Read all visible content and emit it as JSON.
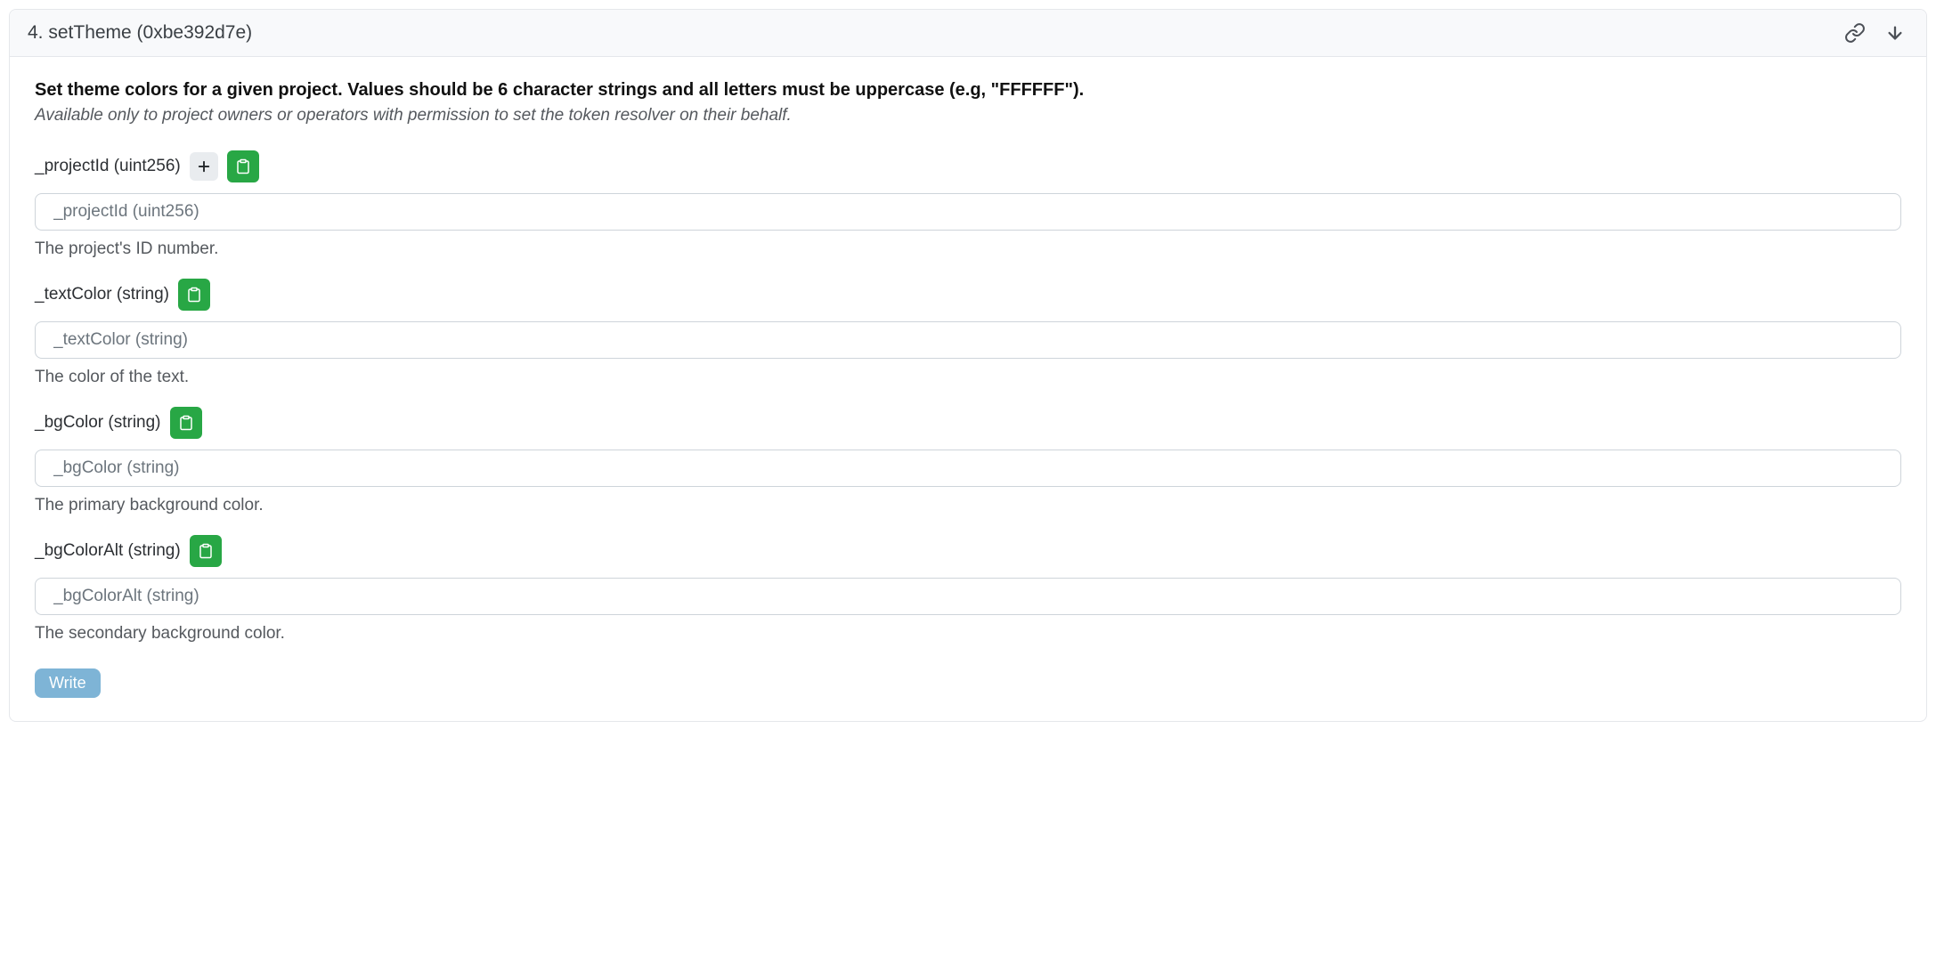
{
  "header": {
    "title": "4. setTheme (0xbe392d7e)"
  },
  "description": {
    "bold": "Set theme colors for a given project. Values should be 6 character strings and all letters must be uppercase (e.g, \"FFFFFF\").",
    "italic": "Available only to project owners or operators with permission to set the token resolver on their behalf."
  },
  "params": [
    {
      "label": "_projectId (uint256)",
      "placeholder": "_projectId (uint256)",
      "help": "The project's ID number.",
      "hasPlus": true
    },
    {
      "label": "_textColor (string)",
      "placeholder": "_textColor (string)",
      "help": "The color of the text.",
      "hasPlus": false
    },
    {
      "label": "_bgColor (string)",
      "placeholder": "_bgColor (string)",
      "help": "The primary background color.",
      "hasPlus": false
    },
    {
      "label": "_bgColorAlt (string)",
      "placeholder": "_bgColorAlt (string)",
      "help": "The secondary background color.",
      "hasPlus": false
    }
  ],
  "actions": {
    "write": "Write"
  }
}
